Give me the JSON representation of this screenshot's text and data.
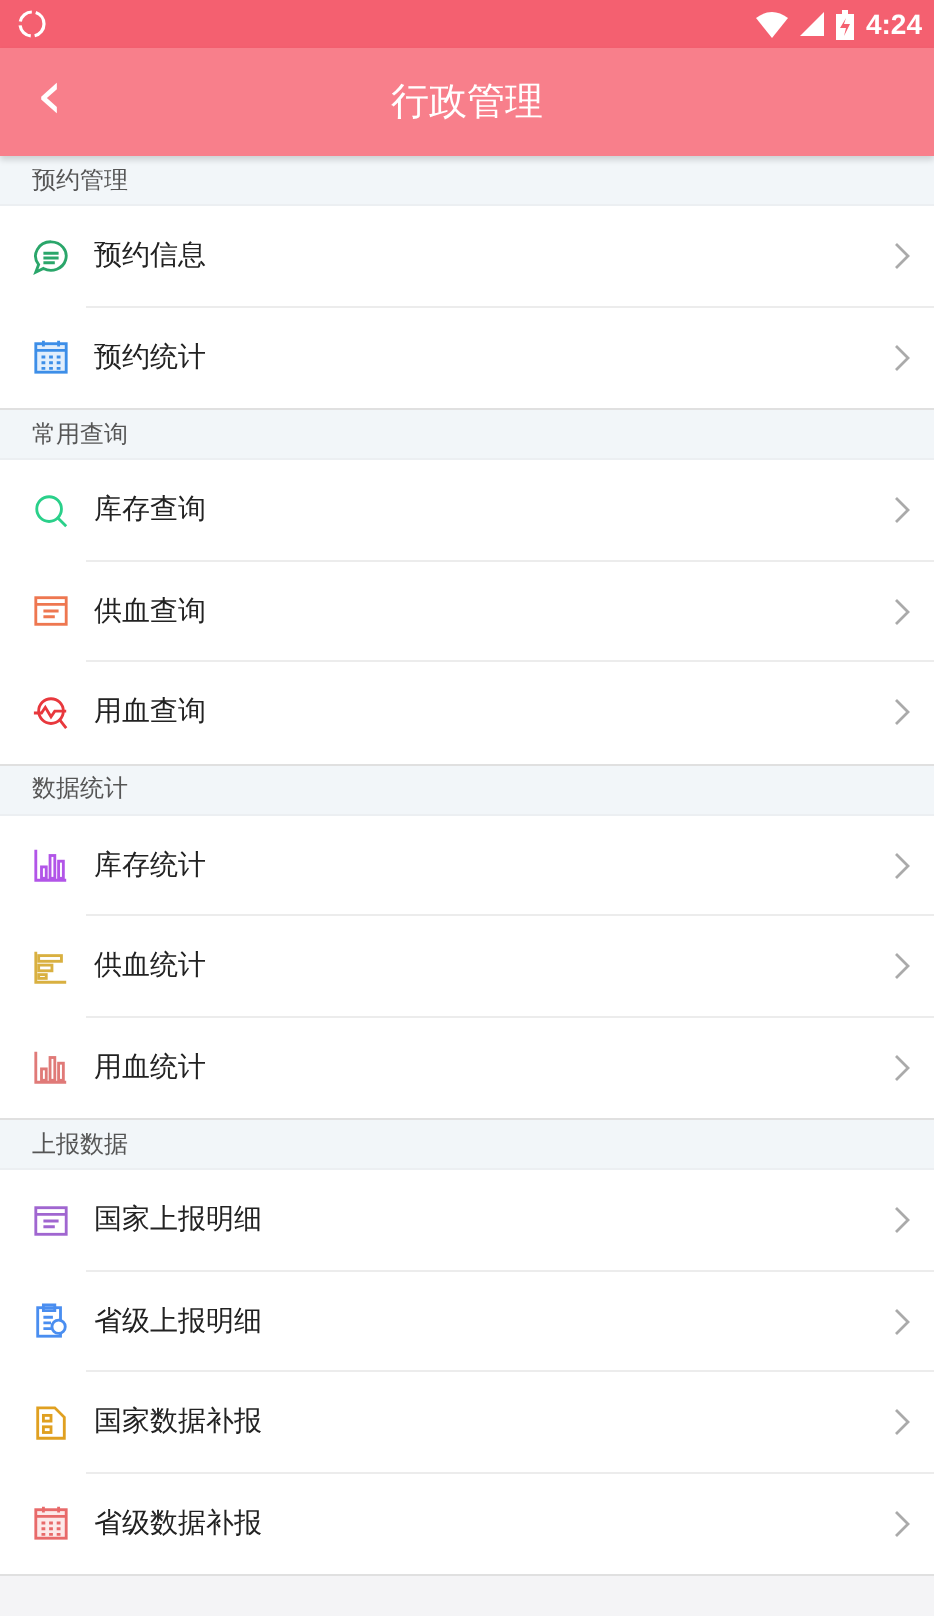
{
  "status_bar": {
    "time": "4:24"
  },
  "header": {
    "back": "‹",
    "title": "行政管理"
  },
  "sections": [
    {
      "title": "预约管理",
      "items": [
        {
          "label": "预约信息",
          "kind": "chat",
          "color": "#2aa66a"
        },
        {
          "label": "预约统计",
          "kind": "calendar",
          "color": "#3d8ee8"
        }
      ]
    },
    {
      "title": "常用查询",
      "items": [
        {
          "label": "库存查询",
          "kind": "search",
          "color": "#2ad08a"
        },
        {
          "label": "供血查询",
          "kind": "window",
          "color": "#ee7750"
        },
        {
          "label": "用血查询",
          "kind": "trend",
          "color": "#e8383d"
        }
      ]
    },
    {
      "title": "数据统计",
      "items": [
        {
          "label": "库存统计",
          "kind": "bars",
          "color": "#b255e8"
        },
        {
          "label": "供血统计",
          "kind": "hbars",
          "color": "#d9b040"
        },
        {
          "label": "用血统计",
          "kind": "bars",
          "color": "#e07a78"
        }
      ]
    },
    {
      "title": "上报数据",
      "items": [
        {
          "label": "国家上报明细",
          "kind": "window",
          "color": "#a066d0"
        },
        {
          "label": "省级上报明细",
          "kind": "clipboard",
          "color": "#4a8ef0"
        },
        {
          "label": "国家数据补报",
          "kind": "document",
          "color": "#e0a020"
        },
        {
          "label": "省级数据补报",
          "kind": "calendar",
          "color": "#e86a6a"
        }
      ]
    }
  ]
}
